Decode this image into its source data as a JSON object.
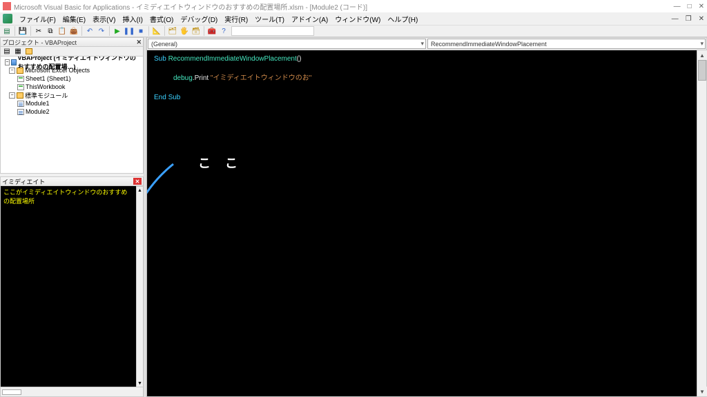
{
  "title": "Microsoft Visual Basic for Applications - イミディエイトウィンドウのおすすめの配置場所.xlsm - [Module2 (コード)]",
  "menu": {
    "file": "ファイル(F)",
    "edit": "編集(E)",
    "view": "表示(V)",
    "insert": "挿入(I)",
    "format": "書式(O)",
    "debug": "デバッグ(D)",
    "run": "実行(R)",
    "tools": "ツール(T)",
    "addins": "アドイン(A)",
    "window": "ウィンドウ(W)",
    "help": "ヘルプ(H)"
  },
  "project_panel": {
    "title": "プロジェクト - VBAProject",
    "tree": {
      "root": "VBAProject (イミディエイトウィンドウのおすすめの配置場…)",
      "excel_objects": "Microsoft Excel Objects",
      "sheet1": "Sheet1 (Sheet1)",
      "thisworkbook": "ThisWorkbook",
      "modules_folder": "標準モジュール",
      "module1": "Module1",
      "module2": "Module2"
    }
  },
  "immediate_panel": {
    "title": "イミディエイト",
    "content": "ここがイミディエイトウィンドウのおすすめの配置場所"
  },
  "code_panel": {
    "selector_left": "(General)",
    "selector_right": "RecommendImmediateWindowPlacement",
    "lines": {
      "l1_kw": "Sub ",
      "l1_name": "RecommendImmediateWindowPlacement",
      "l1_paren": "()",
      "l2_obj": "debug",
      "l2_dot": ".",
      "l2_method": "Print",
      "l2_str": " \"イミディエイトウィンドウのお\"",
      "l3": "End Sub"
    }
  },
  "annotation": "こ こ"
}
